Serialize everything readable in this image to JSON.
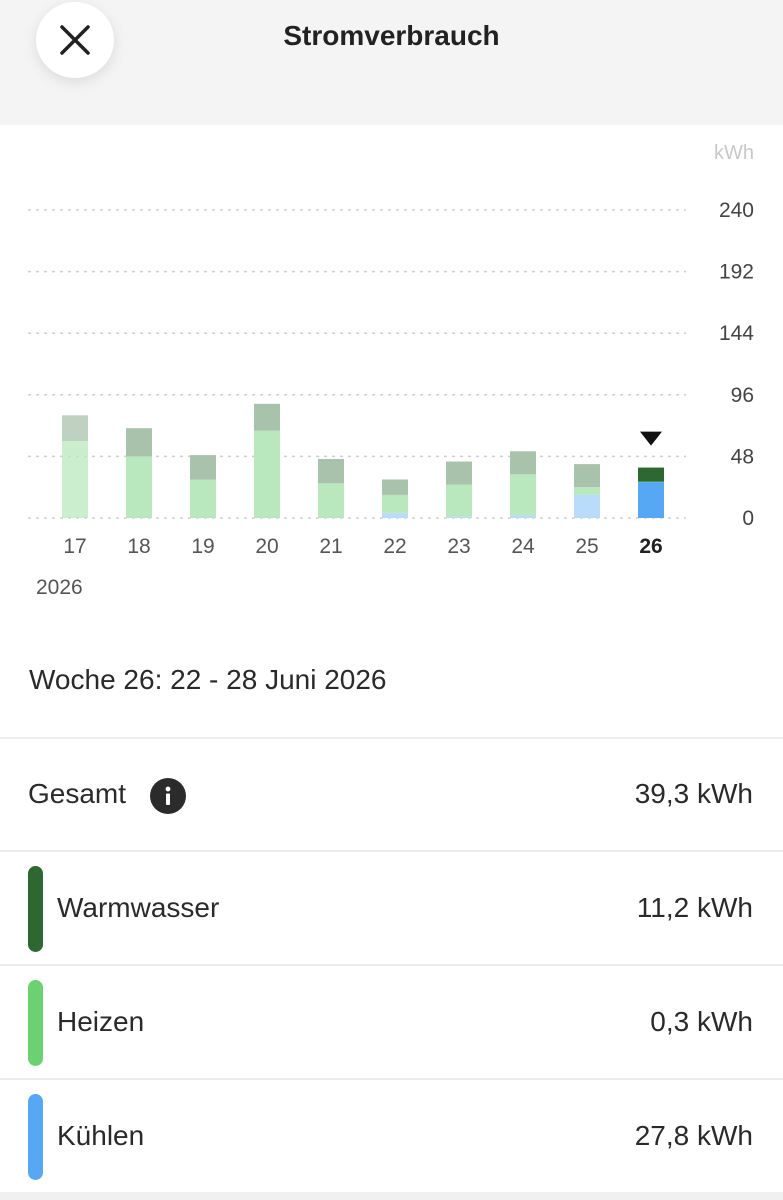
{
  "header": {
    "title": "Stromverbrauch",
    "close_icon": "close-icon"
  },
  "chart_data": {
    "type": "bar",
    "stacked": true,
    "unit": "kWh",
    "x": [
      "17",
      "18",
      "19",
      "20",
      "21",
      "22",
      "23",
      "24",
      "25",
      "26"
    ],
    "year_label": "2026",
    "selected": "26",
    "ylim": [
      0,
      240
    ],
    "yticks": [
      "240",
      "192",
      "144",
      "96",
      "48",
      "0"
    ],
    "ytick_values": [
      240,
      192,
      144,
      96,
      48,
      0
    ],
    "series": [
      {
        "name": "Kühlen",
        "color": "#56a8f5",
        "values": [
          0,
          0,
          0,
          0,
          0,
          4,
          1,
          2,
          18,
          28
        ]
      },
      {
        "name": "Heizen",
        "color": "#6cd170",
        "values": [
          60,
          48,
          30,
          68,
          27,
          14,
          25,
          32,
          6,
          0.3
        ]
      },
      {
        "name": "Warmwasser",
        "color": "#2f6733",
        "values": [
          20,
          22,
          19,
          21,
          19,
          12,
          18,
          18,
          18,
          11
        ]
      }
    ]
  },
  "week_label": "Woche 26: 22 - 28 Juni 2026",
  "summary": {
    "total_label": "Gesamt",
    "total_value": "39,3 kWh",
    "info_icon": "info-icon",
    "rows": [
      {
        "label": "Warmwasser",
        "value": "11,2 kWh",
        "color": "#2f6733"
      },
      {
        "label": "Heizen",
        "value": "0,3 kWh",
        "color": "#6cd170"
      },
      {
        "label": "Kühlen",
        "value": "27,8 kWh",
        "color": "#56a8f5"
      }
    ]
  }
}
